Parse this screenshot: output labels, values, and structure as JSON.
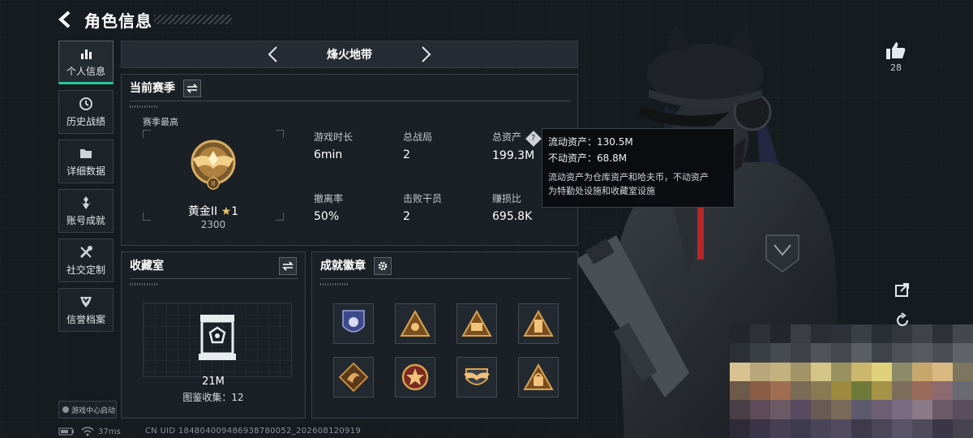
{
  "header": {
    "title": "角色信息"
  },
  "sidebar": {
    "items": [
      {
        "label": "个人信息",
        "icon": "bar-chart-icon",
        "active": true
      },
      {
        "label": "历史战绩",
        "icon": "clock-icon"
      },
      {
        "label": "详细数据",
        "icon": "folder-icon"
      },
      {
        "label": "账号成就",
        "icon": "achievement-icon"
      },
      {
        "label": "社交定制",
        "icon": "tools-icon"
      },
      {
        "label": "信誉档案",
        "icon": "shield-icon"
      }
    ],
    "launch_badge": "游戏中心启动"
  },
  "mode_selector": {
    "current": "烽火地带"
  },
  "season_panel": {
    "title": "当前赛季",
    "season_best_label": "赛季最高",
    "rank_name": "黄金II",
    "rank_stars": "1",
    "rank_score": "2300",
    "stats": [
      {
        "key": "游戏时长",
        "value": "6min"
      },
      {
        "key": "总战局",
        "value": "2"
      },
      {
        "key": "总资产",
        "value": "199.3M"
      },
      {
        "key": "撤离率",
        "value": "50%"
      },
      {
        "key": "击败干员",
        "value": "2"
      },
      {
        "key": "赚损比",
        "value": "695.8K"
      }
    ]
  },
  "tooltip": {
    "liquid": "流动资产：130.5M",
    "fixed": "不动资产：68.8M",
    "desc_line1": "流动资产为仓库资产和哈夫币，不动资产",
    "desc_line2": "为特勤处设施和收藏室设施"
  },
  "vault_panel": {
    "title": "收藏室",
    "value": "21M",
    "collection": "图鉴收集：12"
  },
  "badges_panel": {
    "title": "成就徽章",
    "badges": [
      "badge-police",
      "badge-gold-triangle",
      "badge-gold-gear",
      "badge-gold-tower",
      "badge-dragon",
      "badge-star-shield",
      "badge-wings",
      "badge-bag"
    ]
  },
  "right_ui": {
    "like_count": "28"
  },
  "status_bar": {
    "ping": "37ms",
    "uid": "CN UID 184804009486938780052_202608120919"
  },
  "colors": {
    "accent": "#27c79c",
    "gold": "#c99a4a",
    "panel": "#1c2127"
  }
}
